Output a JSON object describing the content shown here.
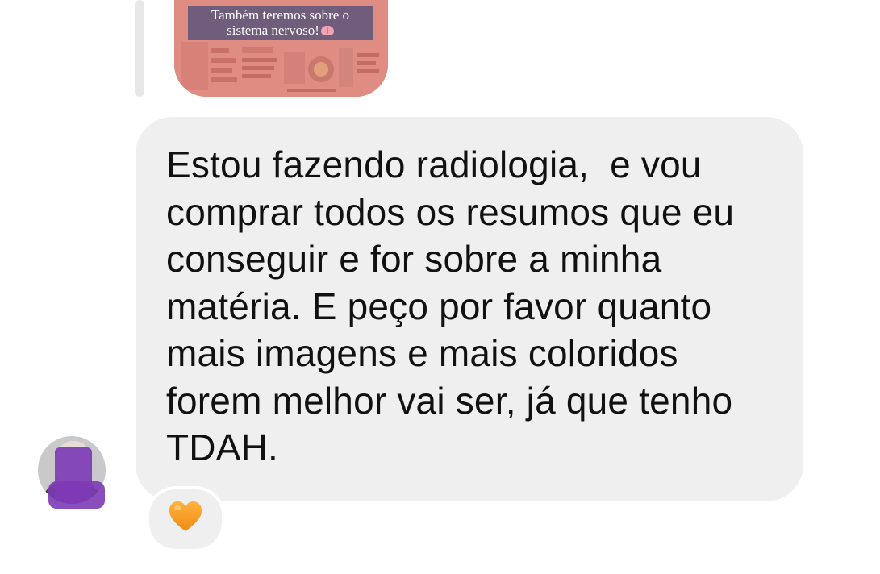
{
  "story_reply": {
    "caption_line1": "Também teremos sobre o",
    "caption_line2": "sistema nervoso!",
    "caption_icon": "brain-icon",
    "thumb_color": "#df8c83"
  },
  "message": {
    "text": "Estou fazendo radiologia,  e vou\ncomprar todos os resumos que eu\nconseguir e for sobre a minha\nmatéria. E peço por favor quanto\nmais imagens e mais coloridos\nforem melhor vai ser, já que tenho\nTDAH.",
    "bubble_color": "#efefef"
  },
  "sender": {
    "avatar_icon": "avatar-icon",
    "redaction_color": "#7d3bb5"
  },
  "reaction": {
    "icon": "orange-heart-icon",
    "color": "#f5a623"
  }
}
